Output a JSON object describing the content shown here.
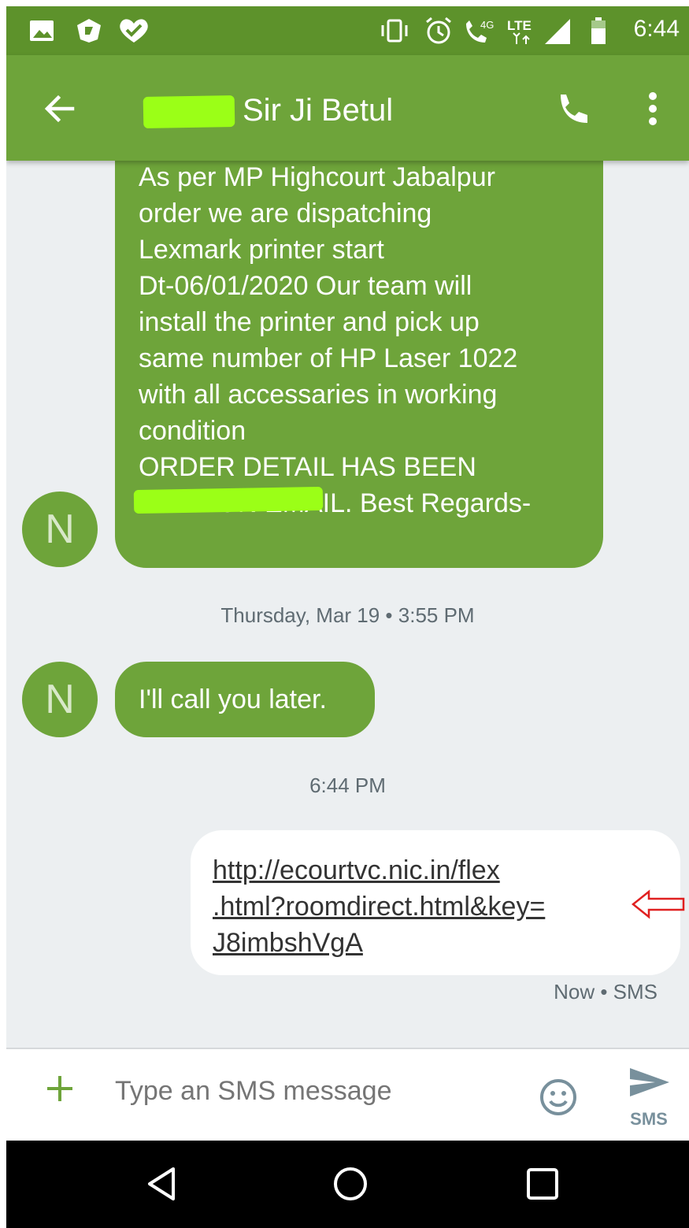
{
  "status_bar": {
    "time": "6:44",
    "icons": [
      "image-icon",
      "app-icon",
      "heart-check-icon",
      "vibrate-icon",
      "alarm-icon",
      "wifi-call-4g-icon",
      "lte-icon",
      "signal-icon",
      "battery-icon"
    ],
    "background": "#5d922b"
  },
  "header": {
    "contact_name": "Sir Ji Betul",
    "background": "#6ea43a"
  },
  "messages": [
    {
      "direction": "incoming",
      "avatar_letter": "N",
      "lines": [
        "As per  MP Highcourt Jabalpur",
        "order we are dispatching",
        "Lexmark printer start",
        "Dt-06/01/2020 Our team will",
        "install the printer and pick up",
        "same number of HP Laser 1022",
        "with all accessaries  in working",
        "condition",
        "ORDER DETAIL HAS BEEN",
        "SENT ON EMAIL. Best Regards-"
      ]
    },
    {
      "direction": "timestamp",
      "text": "Thursday, Mar 19 • 3:55 PM"
    },
    {
      "direction": "incoming",
      "avatar_letter": "N",
      "text": "I'll call you later."
    },
    {
      "direction": "timestamp",
      "text": "6:44 PM"
    },
    {
      "direction": "outgoing",
      "lines": [
        "http://ecourtvc.nic.in/flex",
        ".html?roomdirect.html&key=",
        "J8imbshVgA"
      ],
      "meta": "Now • SMS"
    }
  ],
  "compose": {
    "placeholder": "Type an SMS message",
    "send_label": "SMS"
  },
  "colors": {
    "accent": "#6ea43a",
    "redaction": "#9bff17",
    "annotation_arrow": "#e02020"
  }
}
